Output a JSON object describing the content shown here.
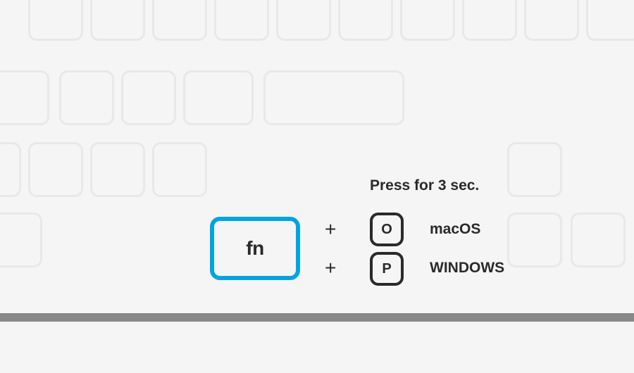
{
  "instruction": "Press for 3 sec.",
  "fn_key": {
    "label": "fn"
  },
  "plus_symbol": "+",
  "shortcuts": [
    {
      "key": "O",
      "os": "macOS"
    },
    {
      "key": "P",
      "os": "WINDOWS"
    }
  ]
}
